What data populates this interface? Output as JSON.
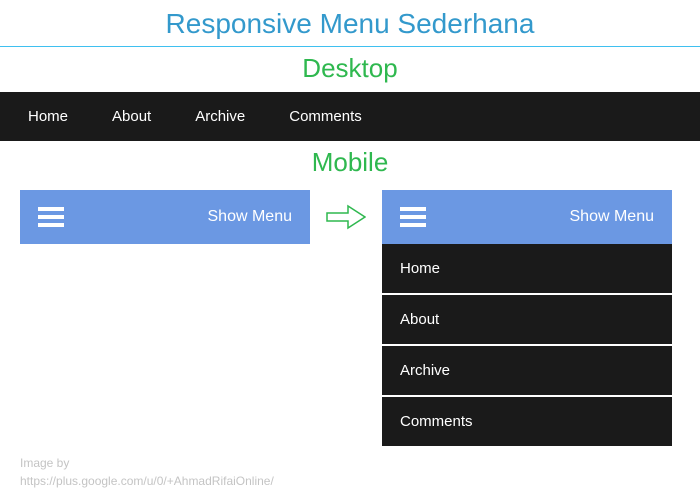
{
  "title": "Responsive Menu Sederhana",
  "sections": {
    "desktop_heading": "Desktop",
    "mobile_heading": "Mobile"
  },
  "nav_items": [
    "Home",
    "About",
    "Archive",
    "Comments"
  ],
  "mobile": {
    "toggle_label": "Show Menu"
  },
  "credit": {
    "line1": "Image by",
    "line2": "https://plus.google.com/u/0/+AhmadRifaiOnline/"
  },
  "colors": {
    "title": "#3399cc",
    "heading": "#2fb84f",
    "navbar_bg": "#1a1a1a",
    "mobile_header_bg": "#6b98e3"
  }
}
